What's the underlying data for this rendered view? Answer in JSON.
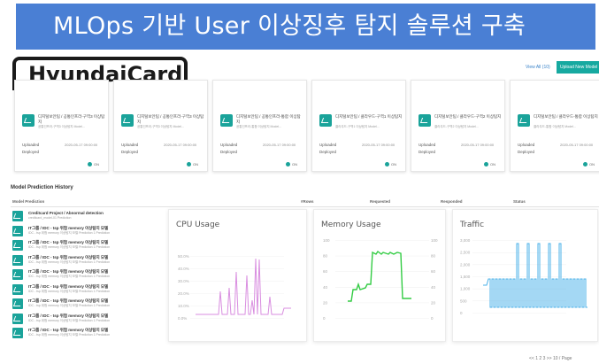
{
  "banner": {
    "title": "MLOps 기반 User 이상징후 탐지 솔루션 구축"
  },
  "logo": {
    "text": "HyundaiCard"
  },
  "topbar": {
    "view_all": "View All (10)",
    "upload_button": "Upload New Model"
  },
  "cards": [
    {
      "title": "디지털보안팀 / 공통인프라-구역3 이상탐지",
      "sub": "공통인프라-구역3 이상탐지 Model...",
      "uploaded_label": "Uploaded",
      "uploaded_value": "2020-05-17 09:00:00",
      "deployed_label": "Deployed",
      "status": "ON",
      "color": "#1aa39a"
    },
    {
      "title": "디지털보안팀 / 공통인프라-구역3 이상탐지",
      "sub": "공통인프라-구역3 이상탐지 Model...",
      "uploaded_label": "Uploaded",
      "uploaded_value": "2020-05-17 09:00:00",
      "deployed_label": "Deployed",
      "status": "ON",
      "color": "#1aa39a"
    },
    {
      "title": "디지털보안팀 / 공통인프라-통합 이상탐지",
      "sub": "공통인프라-통합 이상탐지 Model...",
      "uploaded_label": "Uploaded",
      "uploaded_value": "2020-05-17 09:00:00",
      "deployed_label": "Deployed",
      "status": "ON",
      "color": "#1aa39a"
    },
    {
      "title": "디지털보안팀 / 클라우드-구역1 이상탐지",
      "sub": "클라우드-구역1 이상탐지 Model...",
      "uploaded_label": "Uploaded",
      "uploaded_value": "2020-05-17 09:00:00",
      "deployed_label": "Deployed",
      "status": "ON",
      "color": "#1aa39a"
    },
    {
      "title": "디지털보안팀 / 클라우드-구역2 이상탐지",
      "sub": "클라우드-구역2 이상탐지 Model...",
      "uploaded_label": "Uploaded",
      "uploaded_value": "2020-05-17 09:00:00",
      "deployed_label": "Deployed",
      "status": "ON",
      "color": "#1aa39a"
    },
    {
      "title": "디지털보안팀 / 클라우드-통합 이상탐지",
      "sub": "클라우드-통합 이상탐지 Model...",
      "uploaded_label": "Uploaded",
      "uploaded_value": "2020-05-17 09:00:00",
      "deployed_label": "Deployed",
      "status": "ON",
      "color": "#1aa39a"
    }
  ],
  "history": {
    "title": "Model Prediction History",
    "columns": [
      "Model Prediction",
      "#Rows",
      "Requested",
      "Responded",
      "Status"
    ],
    "rows": [
      {
        "title": "Creditcard Project / Abnormal detection",
        "sub": "creditcard_model-01 Prediction"
      },
      {
        "title": "IT그룹 / IDC - tsp 위험 memory 이상탐지 모델",
        "sub": "IDC - tsp 위험 memory 이상탐지 모델 Prediction 1 Prediction"
      },
      {
        "title": "IT그룹 / IDC - tsp 위험 memory 이상탐지 모델",
        "sub": "IDC - tsp 위험 memory 이상탐지 모델 Prediction 1 Prediction"
      },
      {
        "title": "IT그룹 / IDC - tsp 위험 memory 이상탐지 모델",
        "sub": "IDC - tsp 위험 memory 이상탐지 모델 Prediction 1 Prediction"
      },
      {
        "title": "IT그룹 / IDC - tsp 위험 memory 이상탐지 모델",
        "sub": "IDC - tsp 위험 memory 이상탐지 모델 Prediction 1 Prediction"
      },
      {
        "title": "IT그룹 / IDC - tsp 위험 memory 이상탐지 모델",
        "sub": "IDC - tsp 위험 memory 이상탐지 모델 Prediction 1 Prediction"
      },
      {
        "title": "IT그룹 / IDC - tsp 위험 memory 이상탐지 모델",
        "sub": "IDC - tsp 위험 memory 이상탐지 모델 Prediction 1 Prediction"
      },
      {
        "title": "IT그룹 / IDC - tsp 위험 memory 이상탐지 모델",
        "sub": "IDC - tsp 위험 memory 이상탐지 모델 Prediction 1 Prediction"
      },
      {
        "title": "IT그룹 / IDC - tsp 위험 memory 이상탐지 모델",
        "sub": "IDC - tsp 위험 memory 이상탐지 모델 Prediction 1 Prediction"
      }
    ]
  },
  "panels": {
    "cpu": {
      "title": "CPU Usage",
      "color": "#d98ee0",
      "yticks": [
        "50.0%",
        "40.0%",
        "30.0%",
        "20.0%",
        "10.0%",
        "0.0%"
      ]
    },
    "memory": {
      "title": "Memory Usage",
      "color": "#33cc44",
      "yticks_left": [
        "100",
        "80",
        "60",
        "40",
        "20",
        "0"
      ],
      "yticks_right": [
        "100",
        "80",
        "60",
        "40",
        "20",
        "0"
      ]
    },
    "traffic": {
      "title": "Traffic",
      "color": "#4ab0e8",
      "yticks": [
        "3,000",
        "2,500",
        "2,000",
        "1,500",
        "1,000",
        "500",
        "0"
      ]
    }
  },
  "pager": {
    "text": "<< 1 2 3 >>   10 / Page"
  }
}
